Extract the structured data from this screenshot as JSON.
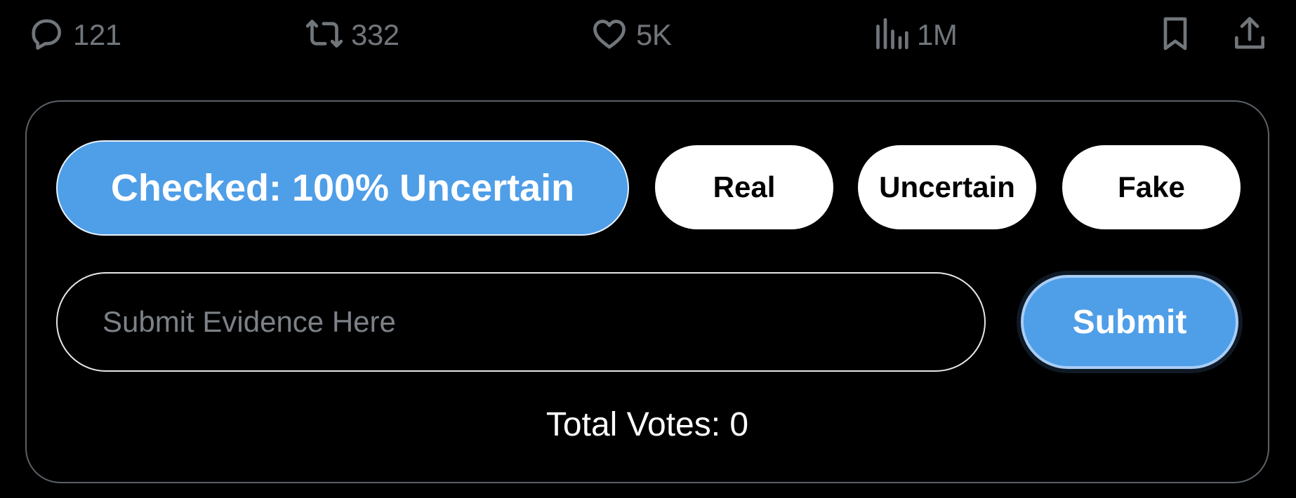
{
  "actions": {
    "reply_count": "121",
    "repost_count": "332",
    "like_count": "5K",
    "views_count": "1M"
  },
  "icons": {
    "reply": "reply-icon",
    "repost": "repost-icon",
    "like": "heart-icon",
    "views": "views-icon",
    "bookmark": "bookmark-icon",
    "share": "share-icon"
  },
  "fact_check": {
    "status_label": "Checked: 100% Uncertain",
    "vote_options": [
      "Real",
      "Uncertain",
      "Fake"
    ],
    "evidence_placeholder": "Submit Evidence Here",
    "evidence_value": "",
    "submit_label": "Submit",
    "total_votes_label": "Total Votes: 0"
  },
  "colors": {
    "background": "#000000",
    "accent_blue": "#4f9ee8",
    "muted_gray": "#71767b",
    "card_border": "#5b6066"
  }
}
